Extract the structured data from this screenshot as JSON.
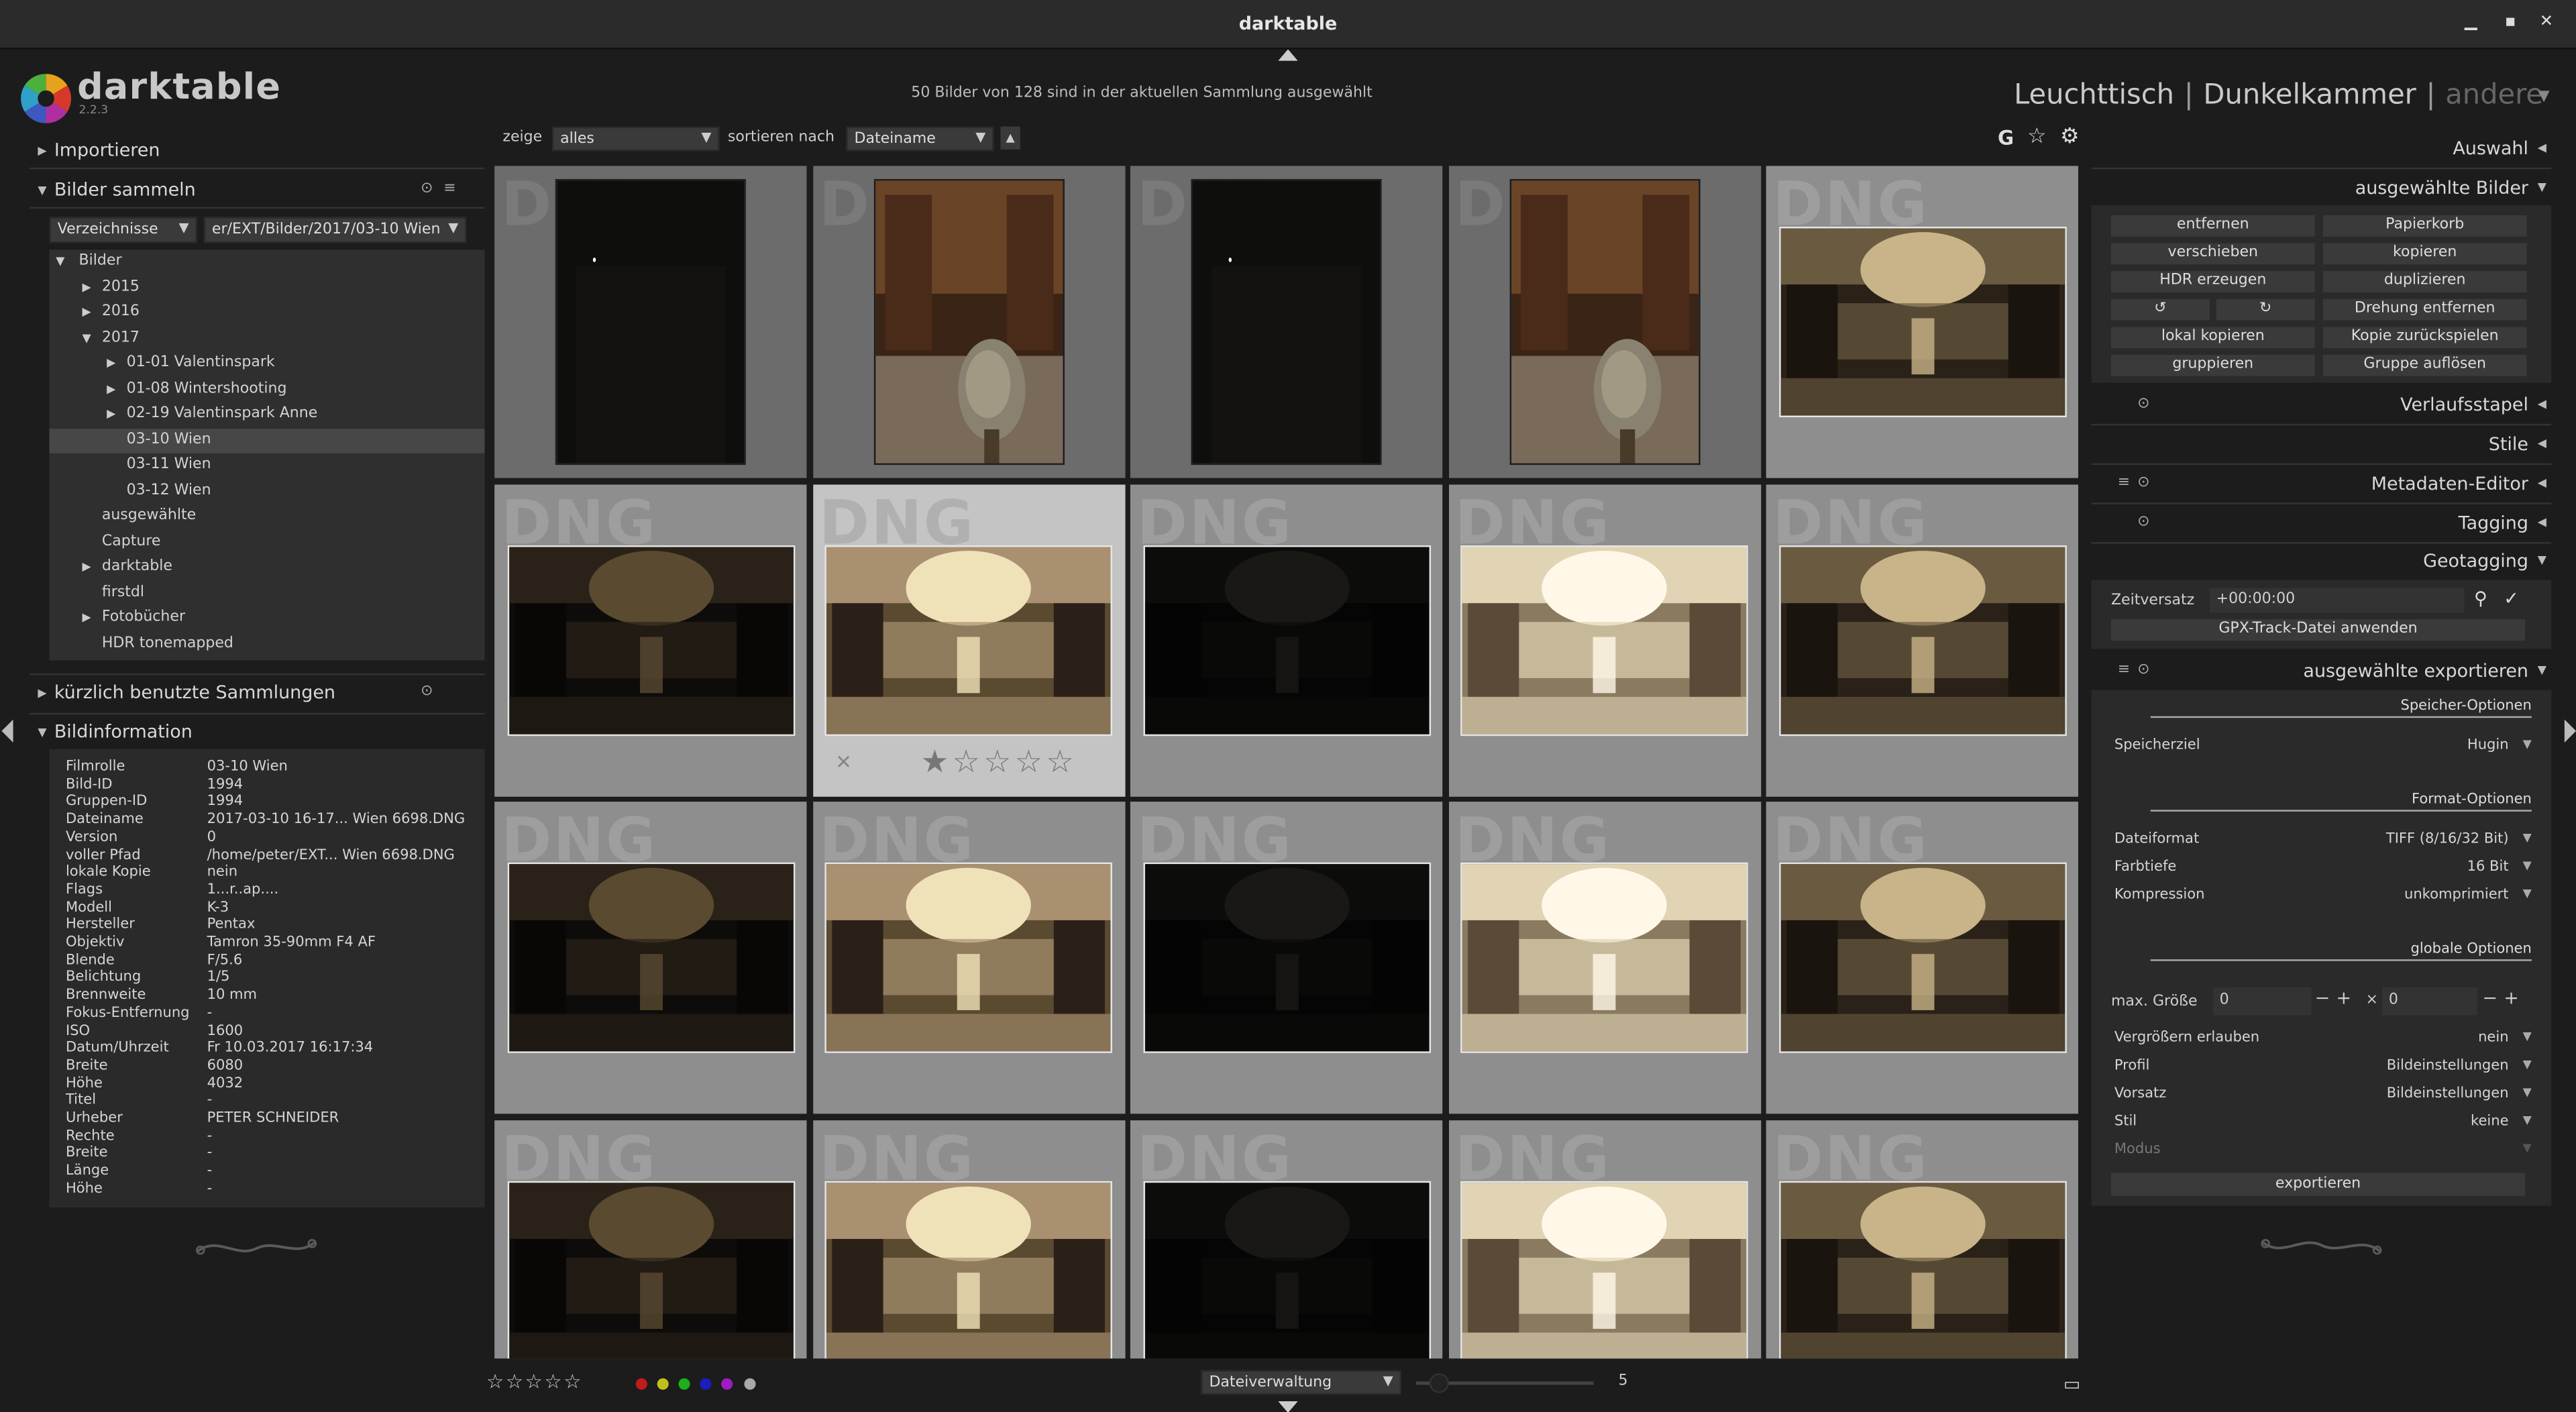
{
  "window": {
    "title": "darktable"
  },
  "app": {
    "name": "darktable",
    "version": "2.2.3"
  },
  "header": {
    "collection_info": "50 Bilder von 128 sind in der aktuellen Sammlung ausgewählt",
    "views": [
      "Leuchttisch",
      "Dunkelkammer",
      "andere"
    ]
  },
  "left": {
    "import_label": "Importieren",
    "collect": {
      "label": "Bilder sammeln",
      "property": "Verzeichnisse",
      "path": "er/EXT/Bilder/2017/03-10 Wien",
      "tree": [
        {
          "label": "Bilder",
          "expander": "▼"
        },
        {
          "label": "2015",
          "expander": "▶"
        },
        {
          "label": "2016",
          "expander": "▶"
        },
        {
          "label": "2017",
          "expander": "▼"
        },
        {
          "label": "01-01 Valentinspark",
          "expander": "▶"
        },
        {
          "label": "01-08 Wintershooting",
          "expander": "▶"
        },
        {
          "label": "02-19 Valentinspark Anne",
          "expander": "▶"
        },
        {
          "label": "03-10 Wien",
          "expander": ""
        },
        {
          "label": "03-11 Wien",
          "expander": ""
        },
        {
          "label": "03-12 Wien",
          "expander": ""
        },
        {
          "label": "ausgewählte",
          "expander": ""
        },
        {
          "label": "Capture",
          "expander": ""
        },
        {
          "label": "darktable",
          "expander": "▶"
        },
        {
          "label": "firstdl",
          "expander": ""
        },
        {
          "label": "Fotobücher",
          "expander": "▶"
        },
        {
          "label": "HDR tonemapped",
          "expander": ""
        }
      ]
    },
    "recent_label": "kürzlich benutzte Sammlungen",
    "info_label": "Bildinformation",
    "info": [
      {
        "k": "Filmrolle",
        "v": "03-10 Wien"
      },
      {
        "k": "Bild-ID",
        "v": "1994"
      },
      {
        "k": "Gruppen-ID",
        "v": "1994"
      },
      {
        "k": "Dateiname",
        "v": "2017-03-10 16-17... Wien 6698.DNG"
      },
      {
        "k": "Version",
        "v": "0"
      },
      {
        "k": "voller Pfad",
        "v": "/home/peter/EXT... Wien 6698.DNG"
      },
      {
        "k": "lokale Kopie",
        "v": "nein"
      },
      {
        "k": "Flags",
        "v": "1...r..ap...."
      },
      {
        "k": "Modell",
        "v": "K-3"
      },
      {
        "k": "Hersteller",
        "v": "Pentax"
      },
      {
        "k": "Objektiv",
        "v": "Tamron 35-90mm F4 AF"
      },
      {
        "k": "Blende",
        "v": "F/5.6"
      },
      {
        "k": "Belichtung",
        "v": "1/5"
      },
      {
        "k": "Brennweite",
        "v": "10 mm"
      },
      {
        "k": "Fokus-Entfernung",
        "v": "-"
      },
      {
        "k": "ISO",
        "v": "1600"
      },
      {
        "k": "Datum/Uhrzeit",
        "v": "Fr 10.03.2017 16:17:34"
      },
      {
        "k": "Breite",
        "v": "6080"
      },
      {
        "k": "Höhe",
        "v": "4032"
      },
      {
        "k": "Titel",
        "v": "-"
      },
      {
        "k": "Urheber",
        "v": "PETER SCHNEIDER"
      },
      {
        "k": "Rechte",
        "v": "-"
      },
      {
        "k": "Breite",
        "v": "-"
      },
      {
        "k": "Länge",
        "v": "-"
      },
      {
        "k": "Höhe",
        "v": "-"
      }
    ]
  },
  "filter": {
    "show_label": "zeige",
    "show_value": "alles",
    "sort_label": "sortieren nach",
    "sort_value": "Dateiname",
    "icons": [
      "G",
      "star-icon",
      "gear-icon"
    ]
  },
  "grid": {
    "badge": "DNG",
    "rows": [
      [
        "dark-portrait",
        "library-portrait",
        "dark-portrait",
        "library-portrait",
        "hall-normal"
      ],
      [
        "hall-dark",
        "hall-bright",
        "hall-black",
        "hall-overexposed",
        "hall-normal"
      ],
      [
        "hall-dark",
        "hall-bright",
        "hall-black",
        "hall-overexposed",
        "hall-normal"
      ],
      [
        "hall-dark",
        "hall-bright",
        "hall-black",
        "hall-overexposed",
        "hall-normal"
      ]
    ],
    "hovered_cell": [
      1,
      1
    ],
    "hover_reject": "✕",
    "hover_stars": "★☆☆☆☆"
  },
  "right": {
    "sections": {
      "select": "Auswahl",
      "selected": "ausgewählte Bilder",
      "history": "Verlaufsstapel",
      "styles": "Stile",
      "metadata": "Metadaten-Editor",
      "tagging": "Tagging",
      "geotag": "Geotagging",
      "export": "ausgewählte exportieren"
    },
    "buttons": [
      [
        "entfernen",
        "Papierkorb"
      ],
      [
        "verschieben",
        "kopieren"
      ],
      [
        "HDR erzeugen",
        "duplizieren"
      ],
      [
        "",
        "Drehung entfernen"
      ],
      [
        "lokal kopieren",
        "Kopie zurückspielen"
      ],
      [
        "gruppieren",
        "Gruppe auflösen"
      ]
    ],
    "geotag": {
      "offset_label": "Zeitversatz",
      "offset_value": "+00:00:00",
      "gpx_button": "GPX-Track-Datei anwenden"
    },
    "export": {
      "storage_header": "Speicher-Optionen",
      "target_label": "Speicherziel",
      "target_value": "Hugin",
      "format_header": "Format-Optionen",
      "format_label": "Dateiformat",
      "format_value": "TIFF (8/16/32 Bit)",
      "depth_label": "Farbtiefe",
      "depth_value": "16 Bit",
      "compress_label": "Kompression",
      "compress_value": "unkomprimiert",
      "global_header": "globale Optionen",
      "maxsize_label": "max. Größe",
      "max_w": "0",
      "max_h": "0",
      "times": "×",
      "upscale_label": "Vergrößern erlauben",
      "upscale_value": "nein",
      "profile_label": "Profil",
      "profile_value": "Bildeinstellungen",
      "intent_label": "Vorsatz",
      "intent_value": "Bildeinstellungen",
      "style_label": "Stil",
      "style_value": "keine",
      "mode_label": "Modus",
      "export_button": "exportieren"
    }
  },
  "bottom": {
    "stars": "☆☆☆☆☆",
    "color_labels": [
      "#c01c1c",
      "#c0c01c",
      "#1cb01c",
      "#1c1cc0",
      "#a01cc0",
      "#aaaaaa"
    ],
    "layout_value": "Dateiverwaltung",
    "zoom_value": "5"
  }
}
